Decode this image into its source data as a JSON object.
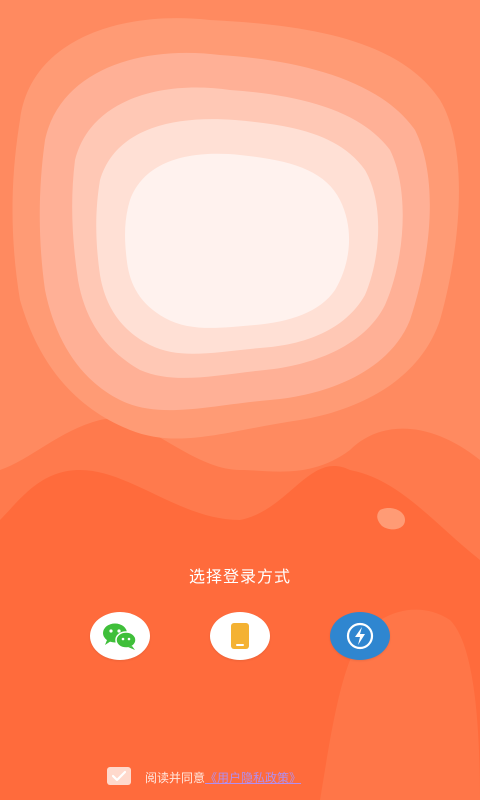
{
  "login": {
    "title": "选择登录方式",
    "methods": [
      {
        "id": "wechat",
        "icon": "wechat-icon",
        "color": "#3fbf3a"
      },
      {
        "id": "phone",
        "icon": "phone-icon",
        "color": "#f4b233"
      },
      {
        "id": "quick",
        "icon": "lightning-icon",
        "color": "#2f86d0"
      }
    ]
  },
  "agreement": {
    "checked": true,
    "text": "阅读并同意",
    "link": "《用户隐私政策》"
  },
  "colors": {
    "background": "#ff6a3a",
    "accent_light": "#fff2ee",
    "link": "#b28ef0"
  }
}
